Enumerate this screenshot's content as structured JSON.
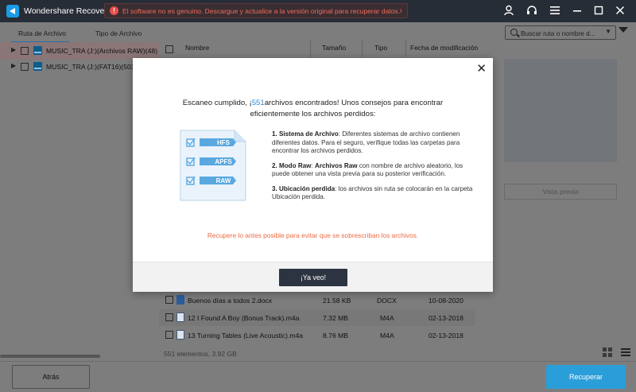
{
  "app": {
    "title": "Wondershare Recoverit",
    "warning": "El software no es genuino. Descargue y actualice a la versión original para recuperar datos.",
    "warning_icon": "!",
    "arrow": "›"
  },
  "sidebar": {
    "tabs": [
      "Ruta de Archivo",
      "Tipo de Archivo"
    ],
    "tree": [
      {
        "label": "MUSIC_TRA (J:)(Archivos RAW)(48)"
      },
      {
        "label": "MUSIC_TRA (J:)(FAT16)(503)"
      }
    ]
  },
  "list": {
    "headers": {
      "name": "Nombre",
      "size": "Tamaño",
      "type": "Tipo",
      "date": "Fecha de modificación"
    },
    "rows": [
      {
        "name": "Buenos días a todos 2.docx",
        "size": "21.58 KB",
        "type": "DOCX",
        "date": "10-08-2020",
        "icon": "docx-file-icon"
      },
      {
        "name": "12 I Found A Boy (Bonus Track).m4a",
        "size": "7.32 MB",
        "type": "M4A",
        "date": "02-13-2018",
        "icon": "audio-file-icon"
      },
      {
        "name": "13 Turning Tables (Live Acoustic).m4a",
        "size": "8.76 MB",
        "type": "M4A",
        "date": "02-13-2018",
        "icon": "audio-file-icon"
      }
    ],
    "summary": "551 elementos, 3.92 GB"
  },
  "right": {
    "search_placeholder": "Buscar ruta o nombre d...",
    "preview_label": "Vista previa"
  },
  "bottom": {
    "back": "Atrás",
    "recover": "Recuperar"
  },
  "modal": {
    "close": "✕",
    "heading_pre": "Escaneo cumplido, ¡",
    "heading_count": "551",
    "heading_post": "archivos encontrados! Unos consejos para encontrar",
    "heading_line2": "eficientemente los archivos perdidos:",
    "tips": [
      {
        "title": "1. Sistema de Archivo",
        "text": ": Diferentes sistemas de archivo contienen diferentes datos. Para el seguro, verifique todas las carpetas para encontrar los archivos perdidos."
      },
      {
        "title": "2. Modo Raw",
        "title2": "Archivos Raw",
        "text": " con nombre de archivo aleatorio, los puede obtener una vista previa para su posterior verificación."
      },
      {
        "title": "3. Ubicación perdida",
        "text": ": los archivos sin ruta se colocarán en la carpeta Ubicación perdida."
      }
    ],
    "illustration_labels": [
      "HFS",
      "APFS",
      "RAW"
    ],
    "warning": "Recupere lo antes posible para evitar que se sobrescriban los archivos.",
    "ok": "¡Ya veo!"
  },
  "colors": {
    "accent": "#2a9ed9",
    "warning_text": "#f16a5c",
    "modal_warning": "#f06a40",
    "count_highlight": "#2a8bd6"
  }
}
